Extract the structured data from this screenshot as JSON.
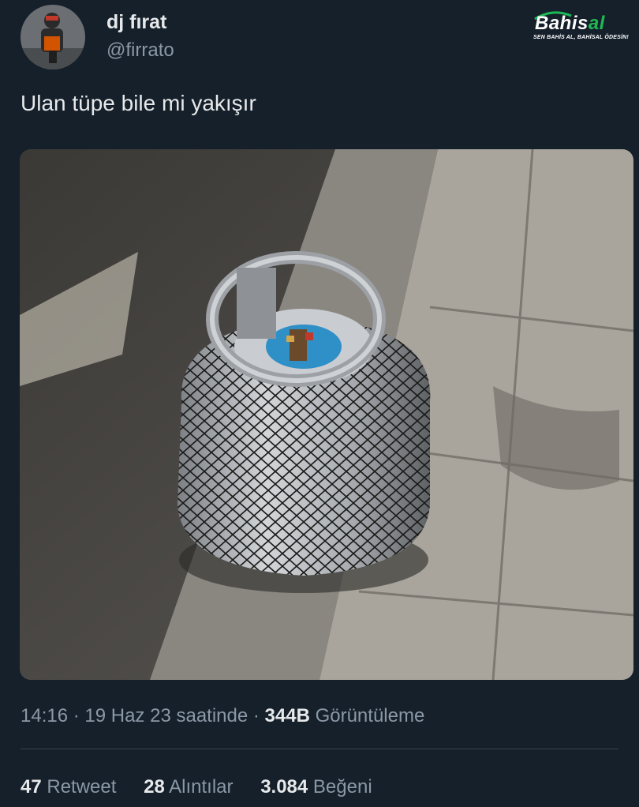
{
  "author": {
    "display_name": "dj fırat",
    "handle": "@firrato"
  },
  "watermark": {
    "brand_prefix": "Bahis",
    "brand_suffix": "al",
    "slogan": "SEN BAHİS AL, BAHİSAL ÖDESİN!",
    "accent_color": "#1db954"
  },
  "tweet": {
    "text": "Ulan tüpe bile mi yakışır"
  },
  "media": {
    "description_icon": "photo-gas-cylinder-in-net"
  },
  "meta": {
    "time": "14:16",
    "sep1": " · ",
    "date": "19 Haz 23 saatinde",
    "sep2": " · ",
    "views_count": "344B",
    "views_label": "Görüntüleme"
  },
  "stats": {
    "retweets_count": "47",
    "retweets_label": "Retweet",
    "quotes_count": "28",
    "quotes_label": "Alıntılar",
    "likes_count": "3.084",
    "likes_label": "Beğeni"
  },
  "colors": {
    "background": "#15202b",
    "primary_text": "#e7e9ea",
    "secondary_text": "#8b98a5",
    "divider": "#38444d"
  }
}
